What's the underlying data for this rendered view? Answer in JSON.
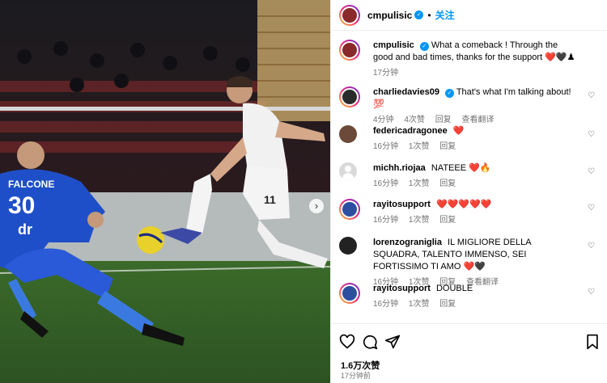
{
  "post": {
    "author": "cmpulisic",
    "follow_label": "关注",
    "caption": "What a comeback ! Through the good and bad times, thanks for the support",
    "caption_emoji": "❤️🖤♟",
    "caption_age": "17分钟",
    "likes": "1.6万次赞",
    "posted": "17分钟前"
  },
  "photo": {
    "jersey_number_goalkeeper": "30",
    "jersey_name_goalkeeper": "FALCONE",
    "jersey_number_player": "11",
    "sponsor": "dr",
    "next_arrow": "›"
  },
  "comments": [
    {
      "user": "charliedavies09",
      "verified": true,
      "text": "That's what I'm talking about! 💯",
      "age": "4分钟",
      "likes": "4次赞",
      "reply": "回复",
      "translate": "查看翻译"
    },
    {
      "user": "federicadragonee",
      "text": "❤️",
      "age": "16分钟",
      "likes": "1次赞",
      "reply": "回复"
    },
    {
      "user": "michh.riojaa",
      "text": "NATEEE ❤️🔥",
      "age": "16分钟",
      "likes": "1次赞",
      "reply": "回复"
    },
    {
      "user": "rayitosupport",
      "text": "❤️❤️❤️❤️❤️",
      "age": "16分钟",
      "likes": "1次赞",
      "reply": "回复"
    },
    {
      "user": "lorenzograniglia",
      "text": "IL MIGLIORE DELLA SQUADRA, TALENTO IMMENSO, SEI FORTISSIMO TI AMO ❤️🖤",
      "age": "16分钟",
      "likes": "1次赞",
      "reply": "回复",
      "translate": "查看翻译"
    },
    {
      "user": "rayitosupport",
      "text": "DOUBLE",
      "age": "16分钟",
      "likes": "1次赞",
      "reply": "回复"
    }
  ],
  "icons": {
    "like": "heart-icon",
    "comment": "comment-icon",
    "share": "share-icon",
    "save": "bookmark-icon",
    "comment_like": "small-heart-icon"
  },
  "colors": {
    "accent": "#0095f6",
    "heart": "#e0245e",
    "meta": "#737373"
  }
}
